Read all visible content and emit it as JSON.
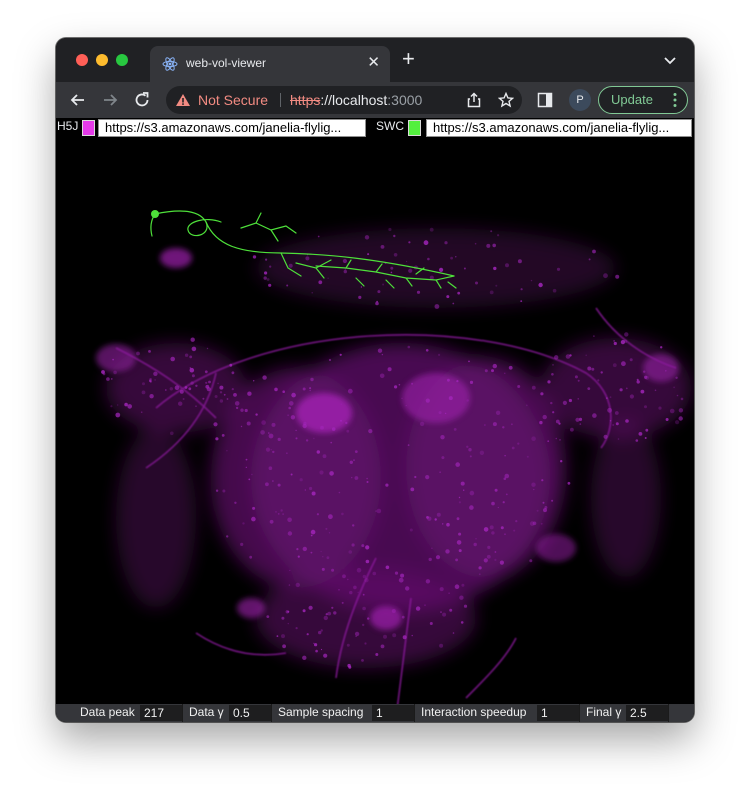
{
  "browser": {
    "tab_title": "web-vol-viewer",
    "security_label": "Not Secure",
    "url_scheme": "https",
    "url_sep": "://",
    "url_host": "localhost",
    "url_port": ":3000",
    "profile_initial": "P",
    "update_label": "Update",
    "icons": [
      "react-favicon-icon",
      "close-icon",
      "plus-icon",
      "chevron-down-icon",
      "back-arrow-icon",
      "forward-arrow-icon",
      "reload-icon",
      "warning-icon",
      "share-icon",
      "star-icon",
      "side-panel-icon",
      "kebab-menu-icon"
    ]
  },
  "inputs": {
    "h5j_label": "H5J",
    "h5j_color": "#e43ae9",
    "h5j_url": "https://s3.amazonaws.com/janelia-flylig...",
    "swc_label": "SWC",
    "swc_color": "#53f03e",
    "swc_url": "https://s3.amazonaws.com/janelia-flylig..."
  },
  "colors": {
    "volume": "#a01fb0",
    "neuron": "#4ee03a"
  },
  "controls": {
    "data_peak": {
      "label": "Data peak",
      "value": "217"
    },
    "data_gamma": {
      "label": "Data γ",
      "value": "0.5"
    },
    "sample_spacing": {
      "label": "Sample spacing",
      "value": "1"
    },
    "interaction_speedup": {
      "label": "Interaction speedup",
      "value": "1"
    },
    "final_gamma": {
      "label": "Final γ",
      "value": "2.5"
    }
  }
}
